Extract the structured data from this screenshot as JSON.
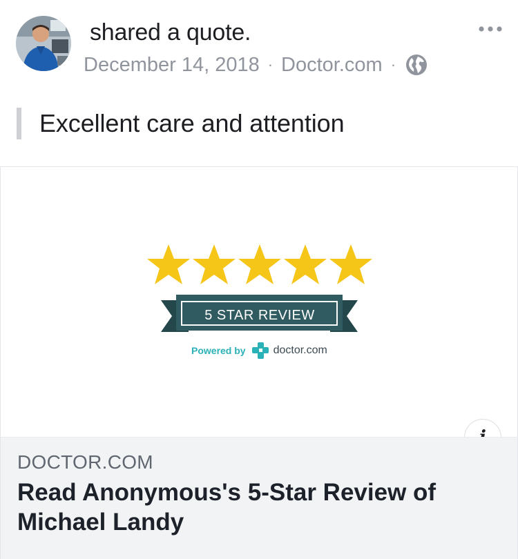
{
  "post": {
    "action_text": "shared a quote.",
    "date": "December 14, 2018",
    "separator": "·",
    "source": "Doctor.com",
    "privacy_icon": "globe-icon",
    "menu_icon": "more-options-icon"
  },
  "quote": {
    "text": "Excellent care and attention"
  },
  "link_card": {
    "badge": {
      "star_rating": 5,
      "star_max": 5,
      "ribbon_text": "5 STAR REVIEW",
      "powered_by": "Powered by",
      "brand": "doctor.com"
    },
    "domain": "DOCTOR.COM",
    "headline": "Read Anonymous's 5-Star Review of Michael Landy",
    "info_icon": "i"
  },
  "colors": {
    "star": "#f5c518",
    "ribbon": "#2f5b61",
    "brand_teal": "#2bb2b8",
    "meta_gray": "#90949c",
    "footer_bg": "#f2f3f5"
  }
}
